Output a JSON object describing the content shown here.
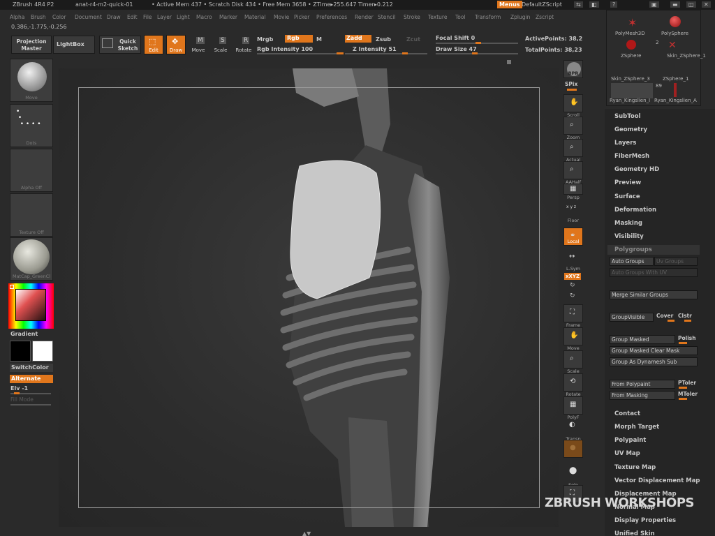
{
  "titlebar": {
    "app": "ZBrush 4R4 P2",
    "file": "anat-r4-m2-quick-01",
    "stats": "• Active Mem 437  • Scratch Disk 434  • Free Mem 3658  • ZTime▸255.647  Timer▸0.212",
    "menus_label": "Menus",
    "script_label": "DefaultZScript"
  },
  "menubar": [
    "Alpha",
    "Brush",
    "Color",
    "Document",
    "Draw",
    "Edit",
    "File",
    "Layer",
    "Light",
    "Macro",
    "Marker",
    "Material",
    "Movie",
    "Picker",
    "Preferences",
    "Render",
    "Stencil",
    "Stroke",
    "Texture",
    "Tool",
    "Transform",
    "Zplugin",
    "Zscript"
  ],
  "coords": "0.386,-1.775,-0.256",
  "toolbar": {
    "projection_master": "Projection Master",
    "lightbox": "LightBox",
    "quick_sketch": "Quick Sketch",
    "edit": "Edit",
    "draw": "Draw",
    "move": "Move",
    "scale": "Scale",
    "rotate": "Rotate",
    "mrgb": "Mrgb",
    "rgb": "Rgb",
    "m": "M",
    "rgb_intensity": "Rgb Intensity 100",
    "zadd": "Zadd",
    "zsub": "Zsub",
    "zcut": "Zcut",
    "z_intensity": "Z Intensity 51",
    "focal_shift": "Focal Shift 0",
    "draw_size": "Draw Size 47",
    "active_points": "ActivePoints: 38,2",
    "total_points": "TotalPoints: 38,23"
  },
  "left_shelf": {
    "brush": "Move",
    "stroke": "Dots",
    "alpha": "Alpha  Off",
    "texture": "Texture  Off",
    "material": "MatCap_GreenCl",
    "gradient": "Gradient",
    "switch_color": "SwitchColor",
    "alternate": "Alternate",
    "elv": "Elv -1",
    "fill_mode": "Fill Mode"
  },
  "right_shelf": [
    "BPR",
    "SPix",
    "Scroll",
    "Zoom",
    "Actual",
    "AAHalf",
    "Persp",
    "Floor",
    "Local",
    "L.Sym",
    "xXYZ",
    "Frame",
    "Move",
    "Scale",
    "Rotate",
    "PolyF",
    "Transp",
    "Ghost",
    "Solo",
    "Xpose"
  ],
  "subtool_panel": {
    "items": [
      "PolyMesh3D",
      "PolySphere",
      "ZSphere",
      "Skin_ZSphere_1",
      "Skin_ZSphere_3",
      "ZSphere_1",
      "Ryan_Kingslien_I",
      "Ryan_Kingslien_A"
    ],
    "count_a": "2",
    "count_b": "89"
  },
  "tool_menu": [
    "SubTool",
    "Geometry",
    "Layers",
    "FiberMesh",
    "Geometry HD",
    "Preview",
    "Surface",
    "Deformation",
    "Masking",
    "Visibility"
  ],
  "polygroups": {
    "header": "Polygroups",
    "auto_groups": "Auto Groups",
    "uv_groups": "Uv Groups",
    "auto_groups_uv": "Auto Groups With UV",
    "merge_similar": "Merge Similar Groups",
    "group_visible": "GroupVisible",
    "coverage": "Cover",
    "clustering": "Clstr",
    "group_masked": "Group Masked",
    "polish": "Polish",
    "group_masked_clear": "Group Masked Clear Mask",
    "group_as_dynamesh": "Group As Dynamesh Sub",
    "from_polypaint": "From Polypaint",
    "ptoler": "PToler",
    "from_masking": "From Masking",
    "mtoler": "MToler"
  },
  "tool_menu_2": [
    "Contact",
    "Morph Target",
    "Polypaint",
    "UV Map",
    "Texture Map",
    "Vector Displacement Map",
    "Displacement Map",
    "Normal Map",
    "Display Properties",
    "Unified Skin"
  ],
  "watermark": "ZBRUSH WORKSHOPS",
  "colors": {
    "accent": "#e0761c",
    "bg": "#2a2a2a",
    "panel": "#252525"
  }
}
